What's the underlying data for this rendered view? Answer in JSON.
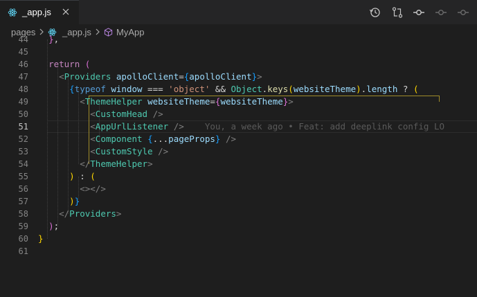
{
  "tab": {
    "label": "_app.js",
    "icon": "react-icon"
  },
  "actions": [
    "history-icon",
    "git-compare-icon",
    "git-commit-icon",
    "git-commit-prev-icon",
    "git-commit-next-icon"
  ],
  "breadcrumb": {
    "folder": "pages",
    "file": "_app.js",
    "symbol": "MyApp"
  },
  "lines": {
    "l44": "44",
    "l45": "45",
    "l46": "46",
    "l47": "47",
    "l48": "48",
    "l49": "49",
    "l50": "50",
    "l51": "51",
    "l52": "52",
    "l53": "53",
    "l54": "54",
    "l55": "55",
    "l56": "56",
    "l57": "57",
    "l58": "58",
    "l59": "59",
    "l60": "60",
    "l61": "61"
  },
  "blame": "You, a week ago • Feat: add deeplink config LO",
  "colors": {
    "background": "#1e1e1e",
    "tag": "#4ec9b0",
    "attribute": "#9cdcfe",
    "keyword": "#c586c0",
    "string": "#ce9178"
  }
}
